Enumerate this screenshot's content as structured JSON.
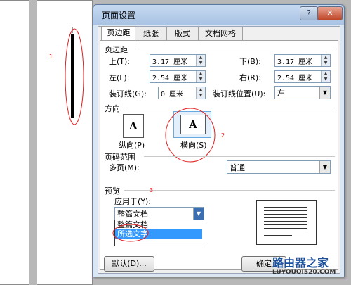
{
  "annotations": {
    "one": "1",
    "two": "2",
    "three": "3"
  },
  "dialog": {
    "title": "页面设置",
    "help_glyph": "?",
    "close_glyph": "✕",
    "tabs": [
      "页边距",
      "纸张",
      "版式",
      "文档网格"
    ],
    "margins": {
      "section": "页边距",
      "top_label": "上(T):",
      "top_value": "3.17 厘米",
      "bottom_label": "下(B):",
      "bottom_value": "3.17 厘米",
      "left_label": "左(L):",
      "left_value": "2.54 厘米",
      "right_label": "右(R):",
      "right_value": "2.54 厘米",
      "gutter_label": "装订线(G):",
      "gutter_value": "0 厘米",
      "gutter_pos_label": "装订线位置(U):",
      "gutter_pos_value": "左"
    },
    "orientation": {
      "section": "方向",
      "icon_glyph": "A",
      "portrait": "纵向(P)",
      "landscape": "横向(S)"
    },
    "pages": {
      "section": "页码范围",
      "multiple_label": "多页(M):",
      "multiple_value": "普通"
    },
    "preview": {
      "section": "预览",
      "apply_label": "应用于(Y):",
      "apply_value": "整篇文档",
      "options": [
        "整篇文档",
        "所选文字"
      ]
    },
    "buttons": {
      "default": "默认(D)...",
      "ok": "确定"
    }
  },
  "watermark": {
    "line1": "路由器之家",
    "line2": "LUYOUQI520.COM"
  }
}
